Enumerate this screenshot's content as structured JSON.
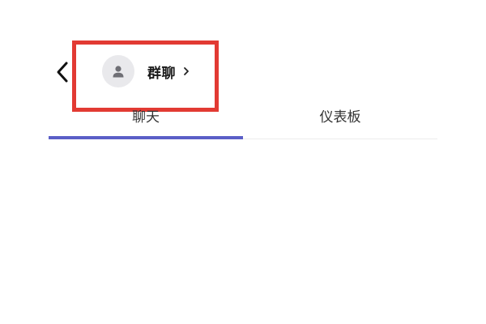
{
  "header": {
    "back_icon": "chevron-left-icon",
    "avatar_icon": "person-icon",
    "title": "群聊",
    "title_chevron_icon": "chevron-right-icon"
  },
  "tabs": [
    {
      "label": "聊天",
      "active": true
    },
    {
      "label": "仪表板",
      "active": false
    }
  ],
  "colors": {
    "accent": "#5b5fc7",
    "highlight": "#e23a33",
    "avatar_bg": "#e9e9ec"
  }
}
